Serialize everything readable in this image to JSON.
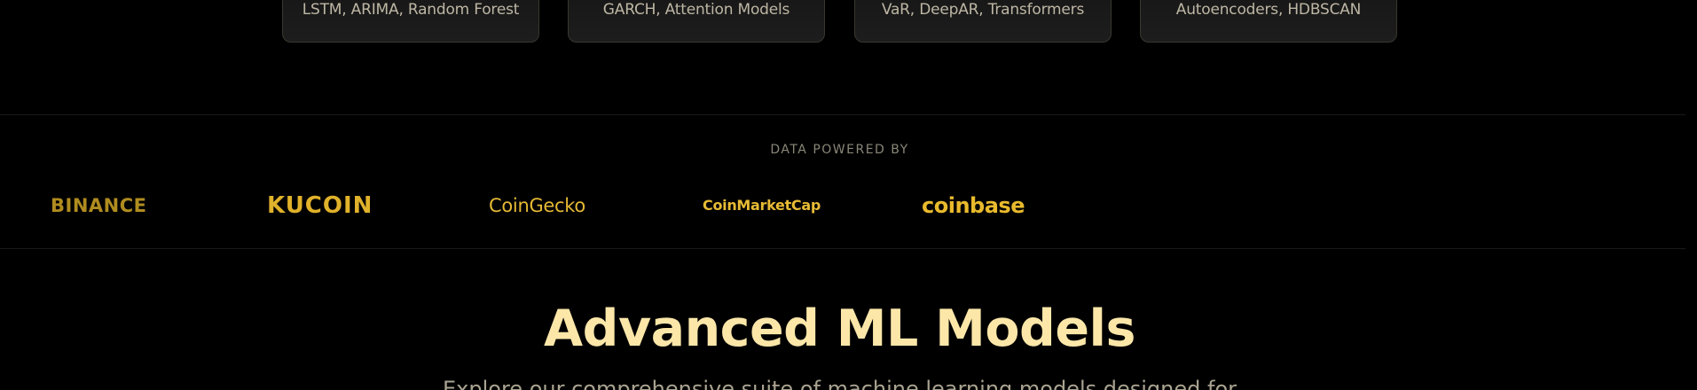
{
  "model_cards": [
    {
      "models": "LSTM, ARIMA, Random Forest"
    },
    {
      "models": "GARCH, Attention Models"
    },
    {
      "models": "VaR, DeepAR, Transformers"
    },
    {
      "models": "Autoencoders, HDBSCAN"
    }
  ],
  "partners": {
    "label": "DATA POWERED BY",
    "logos": [
      {
        "name": "BINANCE",
        "color": "#b08c1f"
      },
      {
        "name": "KUCOIN",
        "color": "#e0b12a"
      },
      {
        "name": "CoinGecko",
        "color": "#e5b935"
      },
      {
        "name": "CoinMarketCap",
        "color": "#e7bb35"
      },
      {
        "name": "coinbase",
        "color": "#e9ba2c"
      }
    ]
  },
  "section": {
    "title": "Advanced ML Models",
    "subtitle": "Explore our comprehensive suite of machine learning models designed for"
  },
  "colors": {
    "background": "#000000",
    "accent_gold": "#fce7a9",
    "card_border": "#3a372e"
  }
}
